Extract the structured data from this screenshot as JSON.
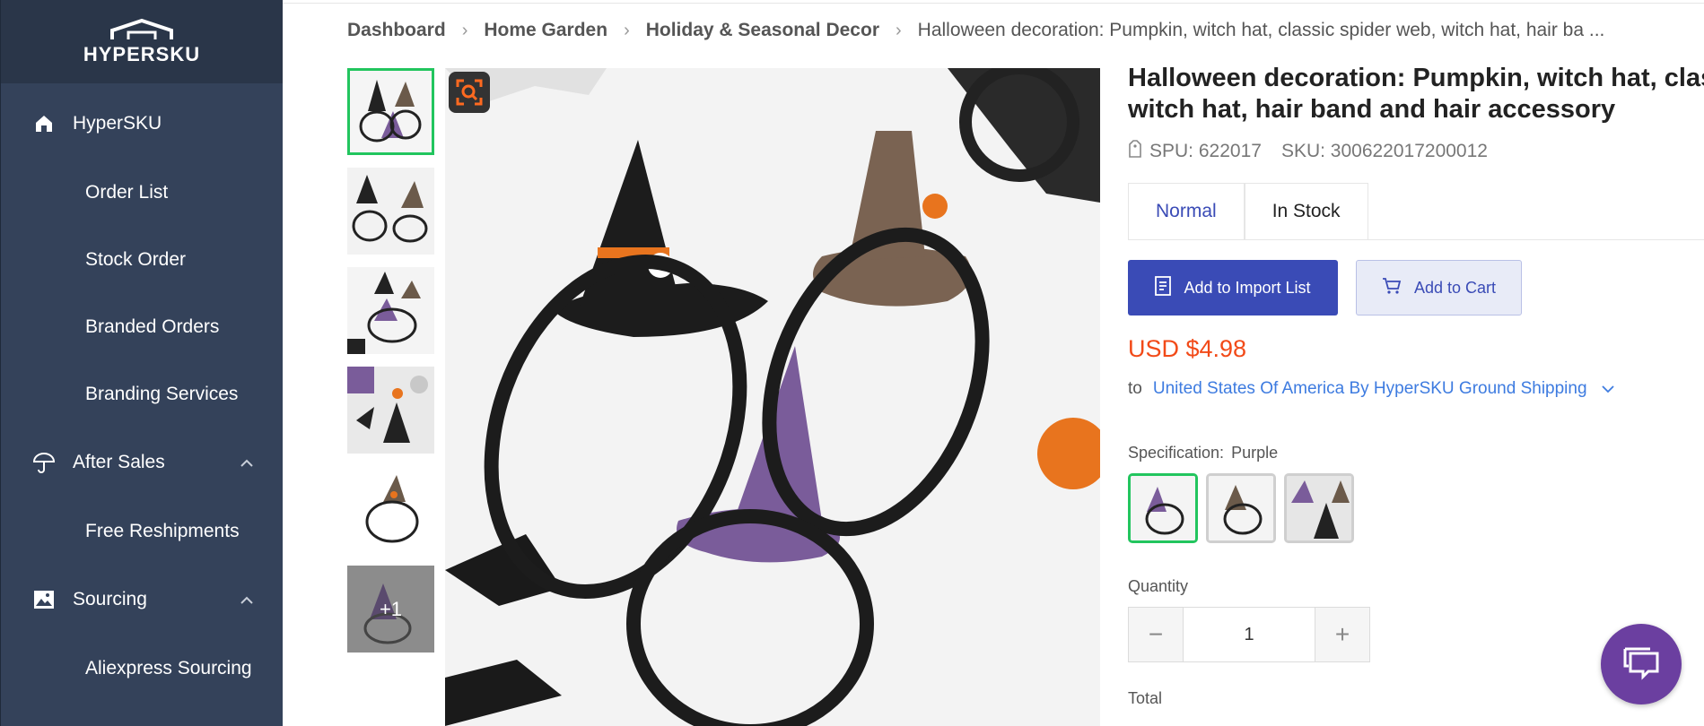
{
  "app": {
    "brand": "HYPERSKU"
  },
  "sidebar": {
    "groups": [
      {
        "label": "HyperSKU",
        "icon": "home-icon"
      },
      {
        "label": "After Sales",
        "icon": "umbrella-icon"
      },
      {
        "label": "Sourcing",
        "icon": "image-icon"
      }
    ],
    "items": {
      "order_list": "Order List",
      "stock_order": "Stock Order",
      "branded_orders": "Branded Orders",
      "branding_services": "Branding Services",
      "free_reshipments": "Free Reshipments",
      "aliexpress_sourcing": "Aliexpress Sourcing"
    }
  },
  "breadcrumb": {
    "items": [
      "Dashboard",
      "Home Garden",
      "Holiday & Seasonal Decor"
    ],
    "current": "Halloween decoration: Pumpkin, witch hat, classic spider web, witch hat, hair ba ..."
  },
  "gallery": {
    "more_label": "+1"
  },
  "product": {
    "title_line1": "Halloween decoration: Pumpkin, witch hat, class",
    "title_line2": "witch hat, hair band and hair accessory",
    "spu": "SPU: 622017",
    "sku": "SKU: 300622017200012",
    "tabs": [
      "Normal",
      "In Stock"
    ],
    "add_import_label": "Add to Import List",
    "add_cart_label": "Add to Cart",
    "price": "USD $4.98",
    "ship_to_label": "to",
    "ship_destination": "United States Of America By HyperSKU Ground Shipping",
    "spec_label": "Specification:",
    "spec_value": "Purple",
    "quantity_label": "Quantity",
    "quantity_value": "1",
    "total_label": "Total"
  },
  "colors": {
    "sidebar_bg": "#34425a",
    "primary": "#3a4bb6",
    "price": "#f24a18",
    "link": "#3d7be0",
    "active_border": "#22c55e",
    "chat": "#6b3fa0"
  }
}
